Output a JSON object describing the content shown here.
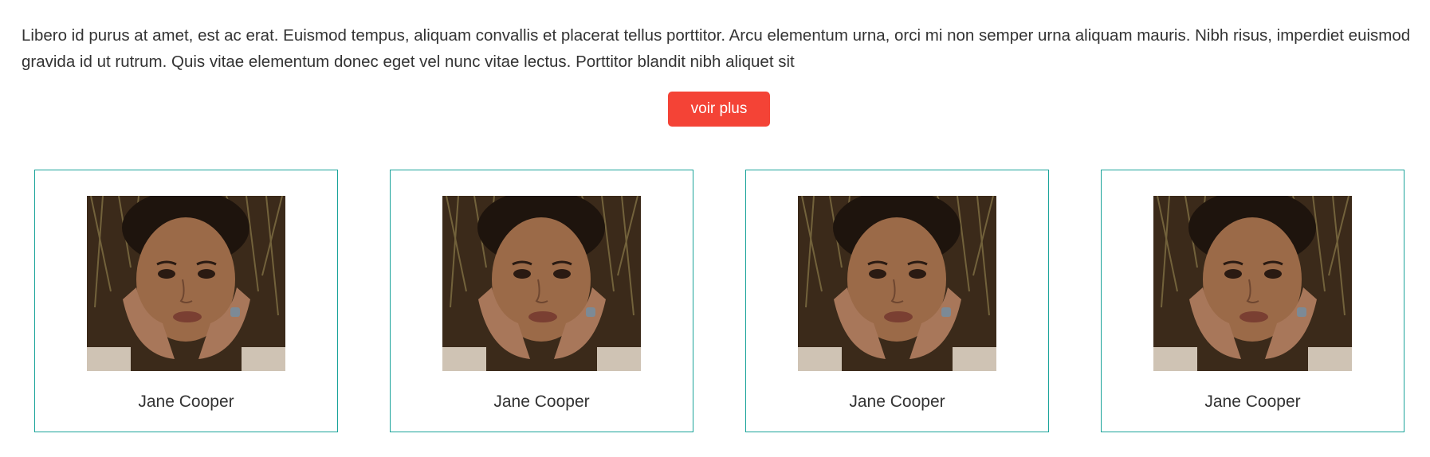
{
  "intro": {
    "text": "Libero id purus at amet, est ac erat. Euismod tempus, aliquam convallis et placerat tellus porttitor. Arcu elementum urna, orci mi non semper urna aliquam mauris. Nibh risus, imperdiet euismod gravida id ut rutrum. Quis vitae elementum donec eget vel nunc vitae lectus. Porttitor blandit nibh aliquet sit"
  },
  "cta": {
    "label": "voir plus",
    "color": "#f44336"
  },
  "theme": {
    "card_border": "#1aa39a"
  },
  "cards": [
    {
      "name": "Jane Cooper",
      "photo_icon": "portrait-photo"
    },
    {
      "name": "Jane Cooper",
      "photo_icon": "portrait-photo"
    },
    {
      "name": "Jane Cooper",
      "photo_icon": "portrait-photo"
    },
    {
      "name": "Jane Cooper",
      "photo_icon": "portrait-photo"
    }
  ]
}
